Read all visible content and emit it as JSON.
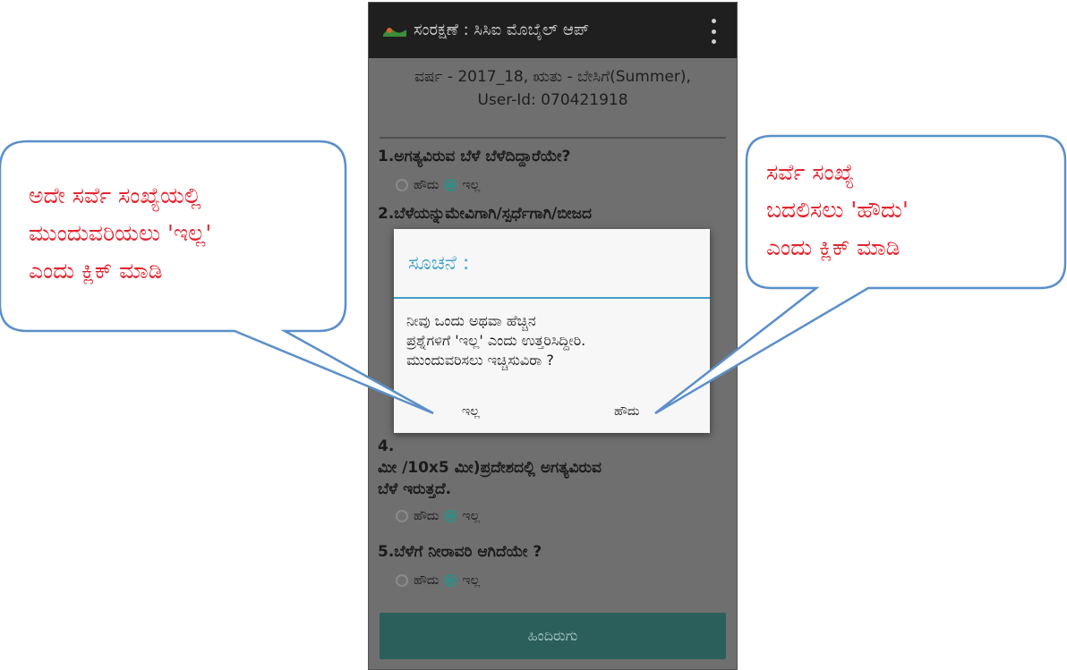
{
  "app": {
    "title": "ಸಂರಕ್ಷಣೆ : ಸಿಸಿಐ ಮೊಬೈಲ್ ಆಪ್",
    "header_line1": "ವರ್ಷ - 2017_18, ಋತು - ಬೇಸಿಗೆ(Summer),",
    "header_line2": "User-Id: 070421918"
  },
  "questions": [
    {
      "text": "1.ಅಗತ್ಯವಿರುವ ಬೆಳೆ ಬೆಳೆದಿದ್ದಾರೆಯೇ?",
      "yes": "ಹೌದು",
      "no": "ಇಲ್ಲ",
      "selected": "no"
    },
    {
      "text": "2.ಬೆಳೆಯನ್ನುಮೇವಿಗಾಗಿ/ಸ್ಪರ್ಧೆಗಾಗಿ/ಬೀಜದ"
    },
    {
      "text_line1": "4.",
      "text_line2": "ಮೀ /10x5 ಮೀ)ಪ್ರದೇಶದಲ್ಲಿ ಅಗತ್ಯವಿರುವ",
      "text_line3": "ಬೆಳೆ ಇರುತ್ತದೆ.",
      "yes": "ಹೌದು",
      "no": "ಇಲ್ಲ",
      "selected": "no"
    },
    {
      "text": "5.ಬೆಳೆಗೆ ನೀರಾವರಿ ಆಗಿದೆಯೇ ?",
      "yes": "ಹೌದು",
      "no": "ಇಲ್ಲ",
      "selected": "no"
    }
  ],
  "bottom_button": "ಹಿಂದಿರುಗು",
  "dialog": {
    "title": "ಸೂಚನೆ :",
    "message_line1": "ನೀವು ಒಂದು ಅಥವಾ ಹೆಚ್ಚಿನ",
    "message_line2": "ಪ್ರಶ್ನೆಗಳಿಗೆ 'ಇಲ್ಲ' ಎಂದು ಉತ್ತರಿಸಿದ್ದೀರಿ.",
    "message_line3": "ಮುಂದುವರಿಸಲು ಇಚ್ಚಿಸುವಿರಾ ?",
    "no_label": "ಇಲ್ಲ",
    "yes_label": "ಹೌದು"
  },
  "callouts": {
    "left": [
      "ಅದೇ ಸರ್ವೆ ಸಂಖ್ಯೆಯಲ್ಲಿ",
      "ಮುಂದುವರಿಯಲು 'ಇಲ್ಲ'",
      "ಎಂದು ಕ್ಲಿಕ್ ಮಾಡಿ"
    ],
    "right": [
      "ಸರ್ವೆ ಸಂಖ್ಯೆ",
      "ಬದಲಿಸಲು 'ಹೌದು'",
      "ಎಂದು ಕ್ಲಿಕ್ ಮಾಡಿ"
    ]
  },
  "colors": {
    "accent": "#3ea0c8",
    "callout_text": "#e4232d",
    "callout_border": "#5b8fc9",
    "radio_selected": "#2e8f86"
  }
}
